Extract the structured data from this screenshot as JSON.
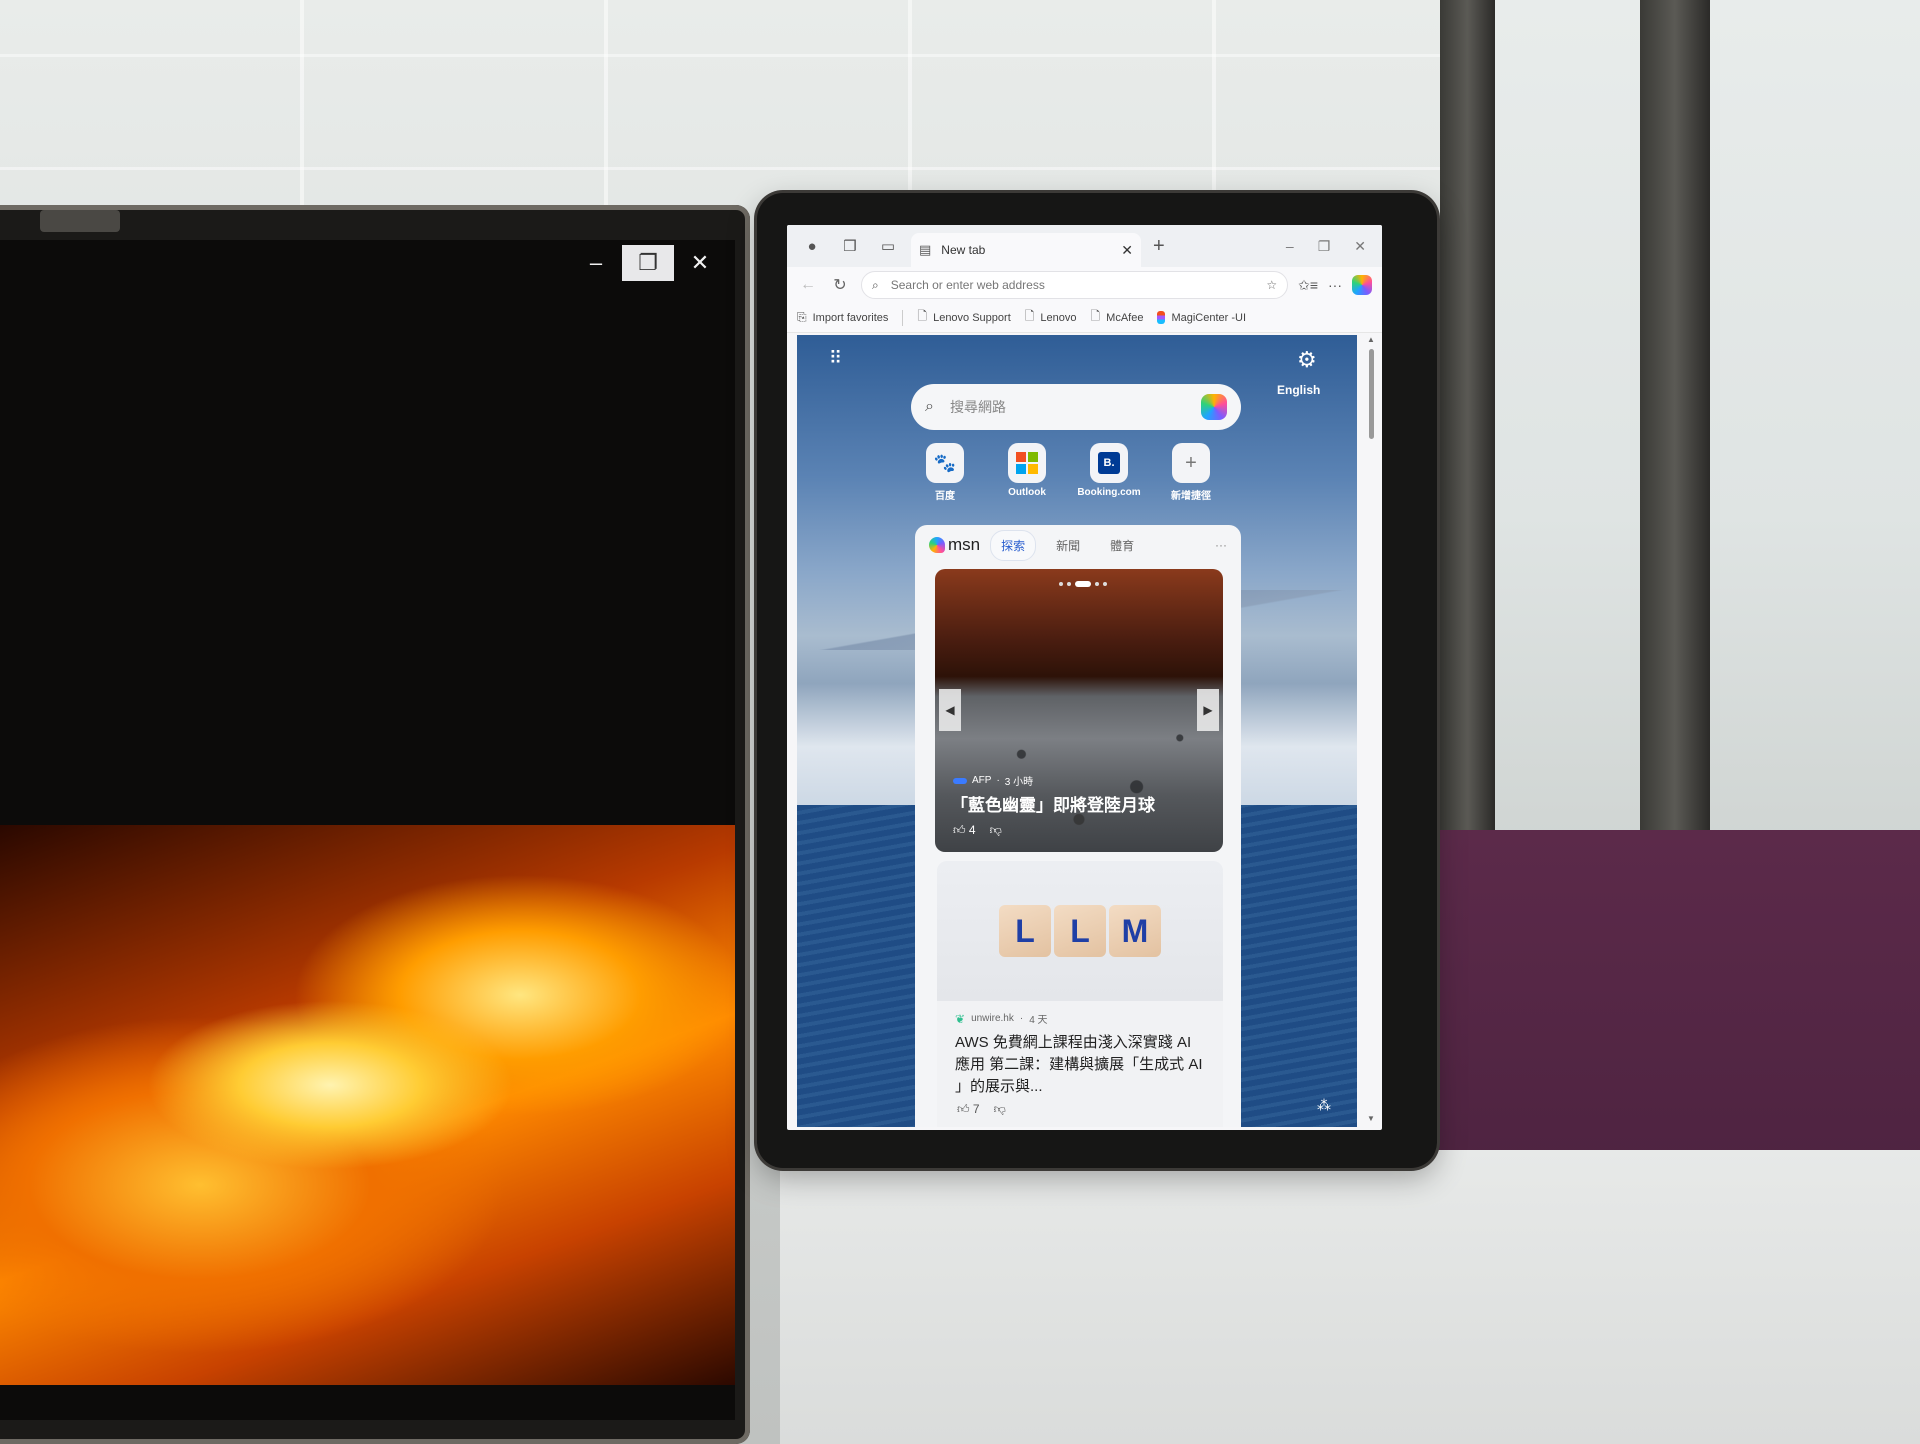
{
  "laptop": {
    "window_controls": {
      "minimize": "–",
      "restore": "❐",
      "close": "✕"
    }
  },
  "browser": {
    "tab": {
      "icon": "new-tab-page-icon",
      "title": "New tab",
      "close": "✕"
    },
    "new_tab_label": "+",
    "window_controls": {
      "minimize": "–",
      "restore": "❐",
      "close": "✕"
    },
    "address": {
      "placeholder": "Search or enter web address"
    },
    "favorites": [
      {
        "label": "Import favorites",
        "icon": "import-icon"
      },
      {
        "label": "Lenovo Support",
        "icon": "page-icon"
      },
      {
        "label": "Lenovo",
        "icon": "page-icon"
      },
      {
        "label": "McAfee",
        "icon": "page-icon"
      },
      {
        "label": "MagiCenter -UI",
        "icon": "figma-icon"
      }
    ]
  },
  "ntp": {
    "language": "English",
    "search_placeholder": "搜尋網路",
    "shortcuts": [
      {
        "label": "百度"
      },
      {
        "label": "Outlook"
      },
      {
        "label": "Booking.com",
        "glyph": "B."
      },
      {
        "label": "新增捷徑",
        "glyph": "+"
      }
    ],
    "feed": {
      "brand": "msn",
      "tabs": [
        "探索",
        "新聞",
        "體育"
      ],
      "active_tab": 0,
      "more": "···",
      "cards": [
        {
          "source": "AFP",
          "time": "3 小時",
          "title": "「藍色幽靈」即將登陸月球",
          "likes": "4",
          "carousel_count": 5,
          "carousel_active": 2
        },
        {
          "source": "unwire.hk",
          "time": "4 天",
          "image_text": [
            "L",
            "L",
            "M"
          ],
          "title": "AWS 免費網上課程由淺入深實踐 AI 應用 第二課：建構與擴展「生成式 AI 」的展示與...",
          "likes": "7"
        }
      ]
    }
  },
  "colors": {
    "accent": "#2b5fcf",
    "booking": "#003b95",
    "baidu": "#2b3fd8"
  }
}
